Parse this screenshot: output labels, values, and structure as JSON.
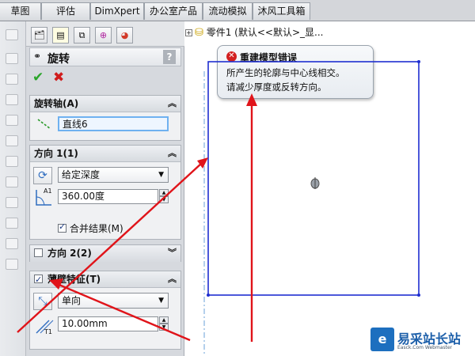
{
  "command_tabs": [
    "草图",
    "评估",
    "DimXpert",
    "办公室产品",
    "流动模拟",
    "沐风工具箱"
  ],
  "property_manager": {
    "title": "旋转",
    "help": "?",
    "tab_icons": [
      "feature-manager-icon",
      "property-manager-icon",
      "configuration-manager-icon",
      "dimxpert-manager-icon",
      "display-manager-icon"
    ],
    "axis_group": {
      "title": "旋转轴(A)",
      "axis_value": "直线6"
    },
    "direction1_group": {
      "title": "方向 1(1)",
      "type_value": "给定深度",
      "angle_value": "360.00度",
      "merge_label": "合并结果(M)",
      "merge_checked": true
    },
    "direction2_group": {
      "title": "方向 2(2)",
      "checked": false
    },
    "thin_group": {
      "title": "薄壁特征(T)",
      "checked": true,
      "type_value": "单向",
      "thickness_value": "10.00mm",
      "t1_label": "T1",
      "a1_label": "A1"
    }
  },
  "graphics": {
    "tree_root": "零件1  (默认<<默认>_显...",
    "error": {
      "title": "重建模型错误",
      "lines": [
        "所产生的轮廓与中心线相交。",
        "请减少厚度或反转方向。"
      ]
    },
    "sketch_color": "#1f2fd0",
    "centerline_color": "#6aa0d8",
    "arrow_color": "#e0141a"
  },
  "watermark": {
    "name": "易采站长站",
    "sub": "Easck.Com Webmaster"
  }
}
